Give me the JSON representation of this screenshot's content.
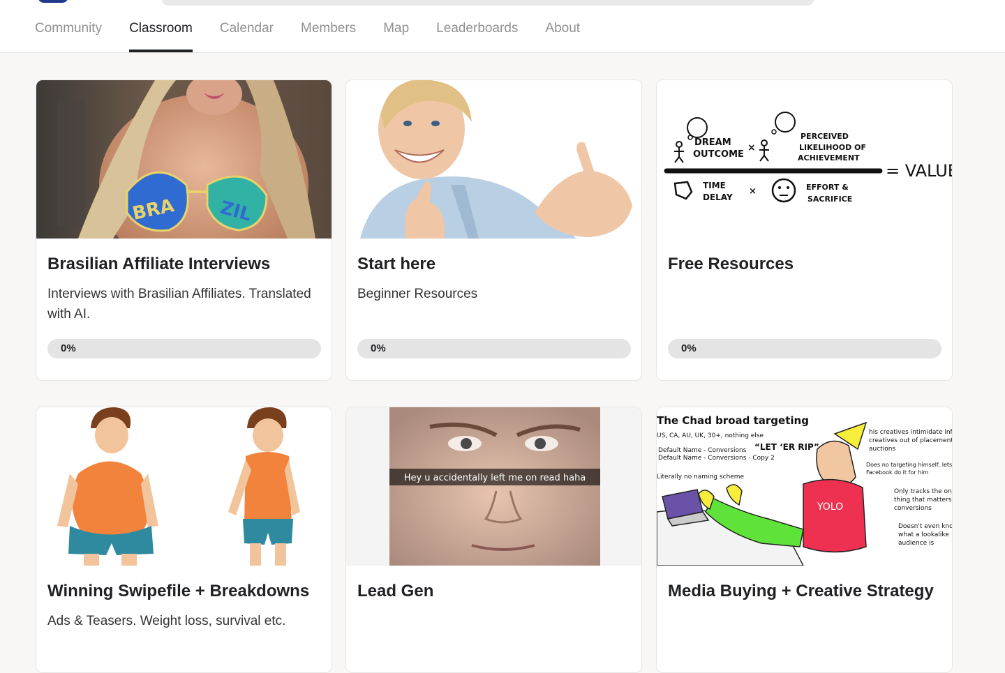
{
  "nav": {
    "tabs": [
      {
        "label": "Community"
      },
      {
        "label": "Classroom",
        "active": true
      },
      {
        "label": "Calendar"
      },
      {
        "label": "Members"
      },
      {
        "label": "Map"
      },
      {
        "label": "Leaderboards"
      },
      {
        "label": "About"
      }
    ]
  },
  "courses": [
    {
      "title": "Brasilian Affiliate Interviews",
      "description": "Interviews with Brasilian Affiliates. Translated with AI.",
      "progress_label": "0%",
      "progress": 0,
      "thumbnail": {
        "icon": "photo-bikini-model",
        "text": "BRAZIL"
      }
    },
    {
      "title": "Start here",
      "description": "Beginner Resources",
      "progress_label": "0%",
      "progress": 0,
      "thumbnail": {
        "icon": "photo-thumbs-up-man"
      }
    },
    {
      "title": "Free Resources",
      "description": "",
      "progress_label": "0%",
      "progress": 0,
      "thumbnail": {
        "icon": "value-equation-sketch",
        "texts": {
          "dream": "DREAM",
          "outcome": "OUTCOME",
          "perceived": "PERCEIVED",
          "likelihood": "LIKELIHOOD OF",
          "achievement": "ACHIEVEMENT",
          "value": "= VALUE",
          "time": "TIME",
          "delay": "DELAY",
          "effort": "EFFORT &",
          "sacrifice": "SACRIFICE",
          "times": "×"
        }
      }
    },
    {
      "title": "Winning Swipefile + Breakdowns",
      "description": "Ads & Teasers. Weight loss, survival etc.",
      "thumbnail": {
        "icon": "before-after-cartoon"
      }
    },
    {
      "title": "Lead Gen",
      "description": "",
      "thumbnail": {
        "icon": "photo-face-meme",
        "caption": "Hey u accidentally left me on read haha"
      }
    },
    {
      "title": "Media Buying + Creative Strategy",
      "description": "",
      "thumbnail": {
        "icon": "chad-meme",
        "texts": {
          "title": "The Chad broad targeting",
          "geo": "US, CA, AU, UK, 30+, nothing else",
          "naming1": "Default Name - Conversions",
          "naming2": "Default Name - Conversions - Copy 2",
          "naming3": "Literally no naming scheme",
          "quote": "“LET ‘ER RIP”",
          "note1a": "his creatives intimidate inferior",
          "note1b": "creatives out of placement",
          "note1c": "auctions",
          "note2a": "Does no targeting himself, lets",
          "note2b": "Facebook do it for him",
          "note3a": "Only tracks the one",
          "note3b": "thing that matters,",
          "note3c": "conversions",
          "note4a": "Doesn't even know",
          "note4b": "what a lookalike",
          "note4c": "audience is",
          "shirt": "YOLO"
        }
      }
    }
  ],
  "colors": {
    "accent": "#202124",
    "muted": "#909090",
    "background": "#f8f7f5"
  }
}
